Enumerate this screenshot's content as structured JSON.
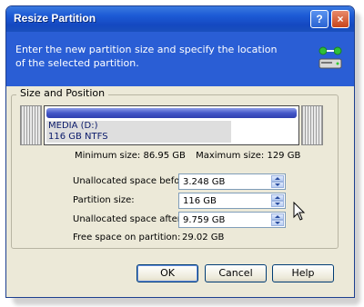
{
  "window": {
    "title": "Resize Partition"
  },
  "titlebar": {
    "help_label": "?",
    "close_label": "×"
  },
  "banner": {
    "text": "Enter the new partition size and specify the location of the selected partition."
  },
  "group": {
    "label": "Size and Position"
  },
  "partition": {
    "name": "MEDIA (D:)",
    "details": "116 GB  NTFS",
    "bar_color": "#4457c8"
  },
  "sizes": {
    "min": "Minimum size: 86.95 GB",
    "max": "Maximum size: 129 GB"
  },
  "fields": {
    "unallocated_before": {
      "label": "Unallocated space before:",
      "value": "3.248 GB"
    },
    "partition_size": {
      "label": "Partition size:",
      "value": "116 GB"
    },
    "unallocated_after": {
      "label": "Unallocated space after:",
      "value": "9.759 GB"
    },
    "free_space": {
      "label": "Free space on partition:",
      "value": "29.02 GB"
    }
  },
  "buttons": {
    "ok": "OK",
    "cancel": "Cancel",
    "help": "Help"
  },
  "colors": {
    "titlebar": "#1d5bd6",
    "banner": "#2a5ed5",
    "dialog_bg": "#ece9d8"
  }
}
